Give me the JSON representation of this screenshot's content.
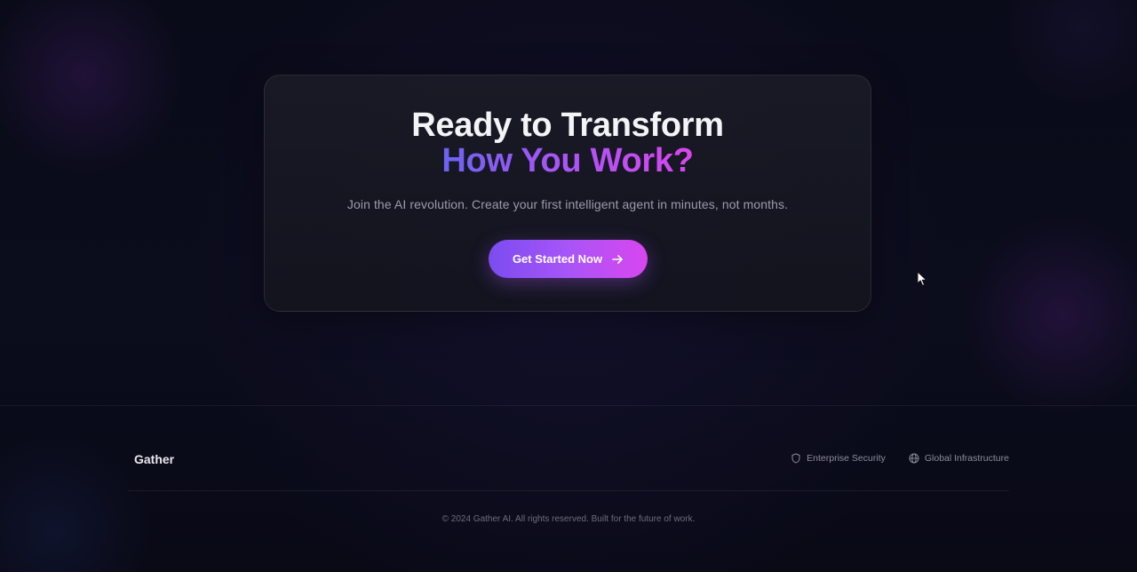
{
  "cta": {
    "title_line1": "Ready to Transform",
    "title_line2": "How You Work?",
    "subtitle": "Join the AI revolution. Create your first intelligent agent in minutes, not months.",
    "button_label": "Get Started Now",
    "button_icon": "arrow-right-icon"
  },
  "footer": {
    "brand": "Gather",
    "badges": [
      {
        "label": "Enterprise Security",
        "icon": "shield-icon"
      },
      {
        "label": "Global Infrastructure",
        "icon": "globe-icon"
      }
    ],
    "copyright": "© 2024 Gather AI. All rights reserved. Built for the future of work."
  },
  "colors": {
    "background": "#0a0b18",
    "accent_start": "#6a64f0",
    "accent_mid": "#a855f7",
    "accent_end": "#d946ef",
    "card_border": "rgba(255,255,255,0.09)"
  }
}
